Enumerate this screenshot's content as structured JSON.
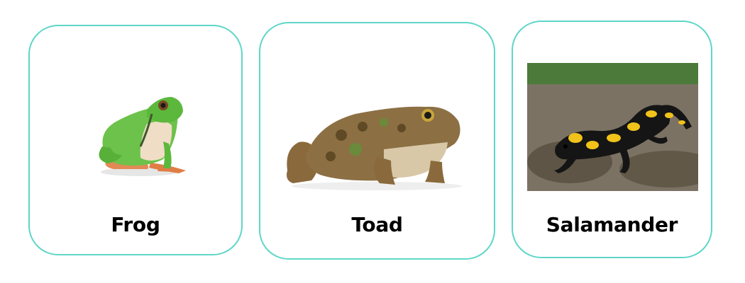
{
  "cards": [
    {
      "label": "Frog",
      "image": "tree-frog-photo"
    },
    {
      "label": "Toad",
      "image": "toad-photo"
    },
    {
      "label": "Salamander",
      "image": "fire-salamander-photo"
    }
  ],
  "colors": {
    "card_border": "#5fd6c8",
    "label_text": "#000000",
    "background": "#ffffff"
  }
}
